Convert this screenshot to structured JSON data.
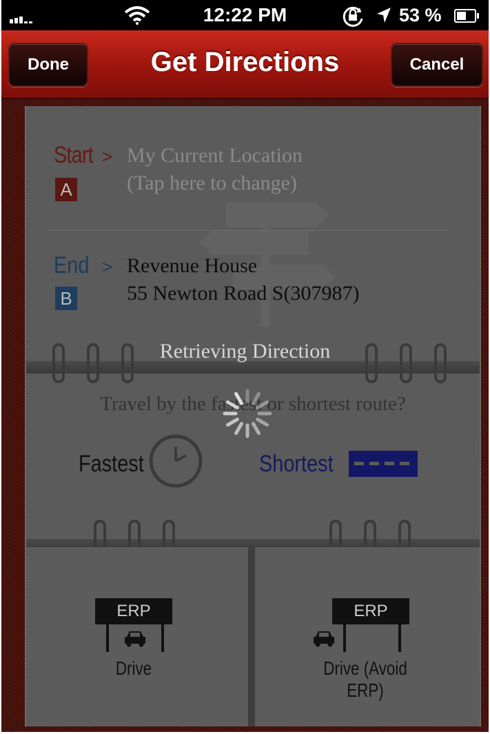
{
  "status_bar": {
    "time": "12:22 PM",
    "battery_text": "53 %",
    "battery_level": 0.53,
    "icons": [
      "signal-icon",
      "wifi-icon",
      "rotation-lock-icon",
      "location-arrow-icon",
      "battery-icon"
    ]
  },
  "navbar": {
    "title": "Get Directions",
    "done_label": "Done",
    "cancel_label": "Cancel"
  },
  "start": {
    "label": "Start",
    "chevron": ">",
    "badge": "A",
    "line1": "My Current Location",
    "line2": "(Tap here to change)"
  },
  "end": {
    "label": "End",
    "chevron": ">",
    "badge": "B",
    "line1": "Revenue House",
    "line2": "55 Newton Road S(307987)"
  },
  "route": {
    "question": "Travel by the fastest or shortest route?",
    "fastest_label": "Fastest",
    "shortest_label": "Shortest"
  },
  "drive_options": {
    "drive_label": "Drive",
    "drive_avoid_label": "Drive (Avoid ERP)",
    "erp_text": "ERP"
  },
  "overlay": {
    "message": "Retrieving Direction"
  },
  "colors": {
    "navbar_red": "#a4170f",
    "start_red": "#631a14",
    "end_blue": "#1e3c5e",
    "shortest_blue": "#151a5a"
  }
}
